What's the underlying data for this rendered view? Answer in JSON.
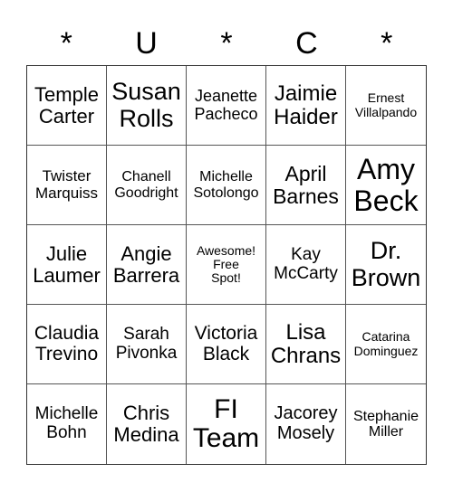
{
  "header": [
    "*",
    "U",
    "*",
    "C",
    "*"
  ],
  "cells": [
    {
      "text": "Temple\nCarter",
      "size": 22
    },
    {
      "text": "Susan\nRolls",
      "size": 27
    },
    {
      "text": "Jeanette\nPacheco",
      "size": 18
    },
    {
      "text": "Jaimie\nHaider",
      "size": 24
    },
    {
      "text": "Ernest\nVillalpando",
      "size": 14
    },
    {
      "text": "Twister\nMarquiss",
      "size": 17
    },
    {
      "text": "Chanell\nGoodright",
      "size": 16
    },
    {
      "text": "Michelle\nSotolongo",
      "size": 16
    },
    {
      "text": "April\nBarnes",
      "size": 23
    },
    {
      "text": "Amy\nBeck",
      "size": 32
    },
    {
      "text": "Julie\nLaumer",
      "size": 22
    },
    {
      "text": "Angie\nBarrera",
      "size": 22
    },
    {
      "text": "Awesome!\nFree\nSpot!",
      "size": 14
    },
    {
      "text": "Kay\nMcCarty",
      "size": 19
    },
    {
      "text": "Dr.\nBrown",
      "size": 27
    },
    {
      "text": "Claudia\nTrevino",
      "size": 21
    },
    {
      "text": "Sarah\nPivonka",
      "size": 19
    },
    {
      "text": "Victoria\nBlack",
      "size": 21
    },
    {
      "text": "Lisa\nChrans",
      "size": 24
    },
    {
      "text": "Catarina\nDominguez",
      "size": 14
    },
    {
      "text": "Michelle\nBohn",
      "size": 19
    },
    {
      "text": "Chris\nMedina",
      "size": 22
    },
    {
      "text": "FI\nTeam",
      "size": 30
    },
    {
      "text": "Jacorey\nMosely",
      "size": 20
    },
    {
      "text": "Stephanie\nMiller",
      "size": 16
    }
  ]
}
